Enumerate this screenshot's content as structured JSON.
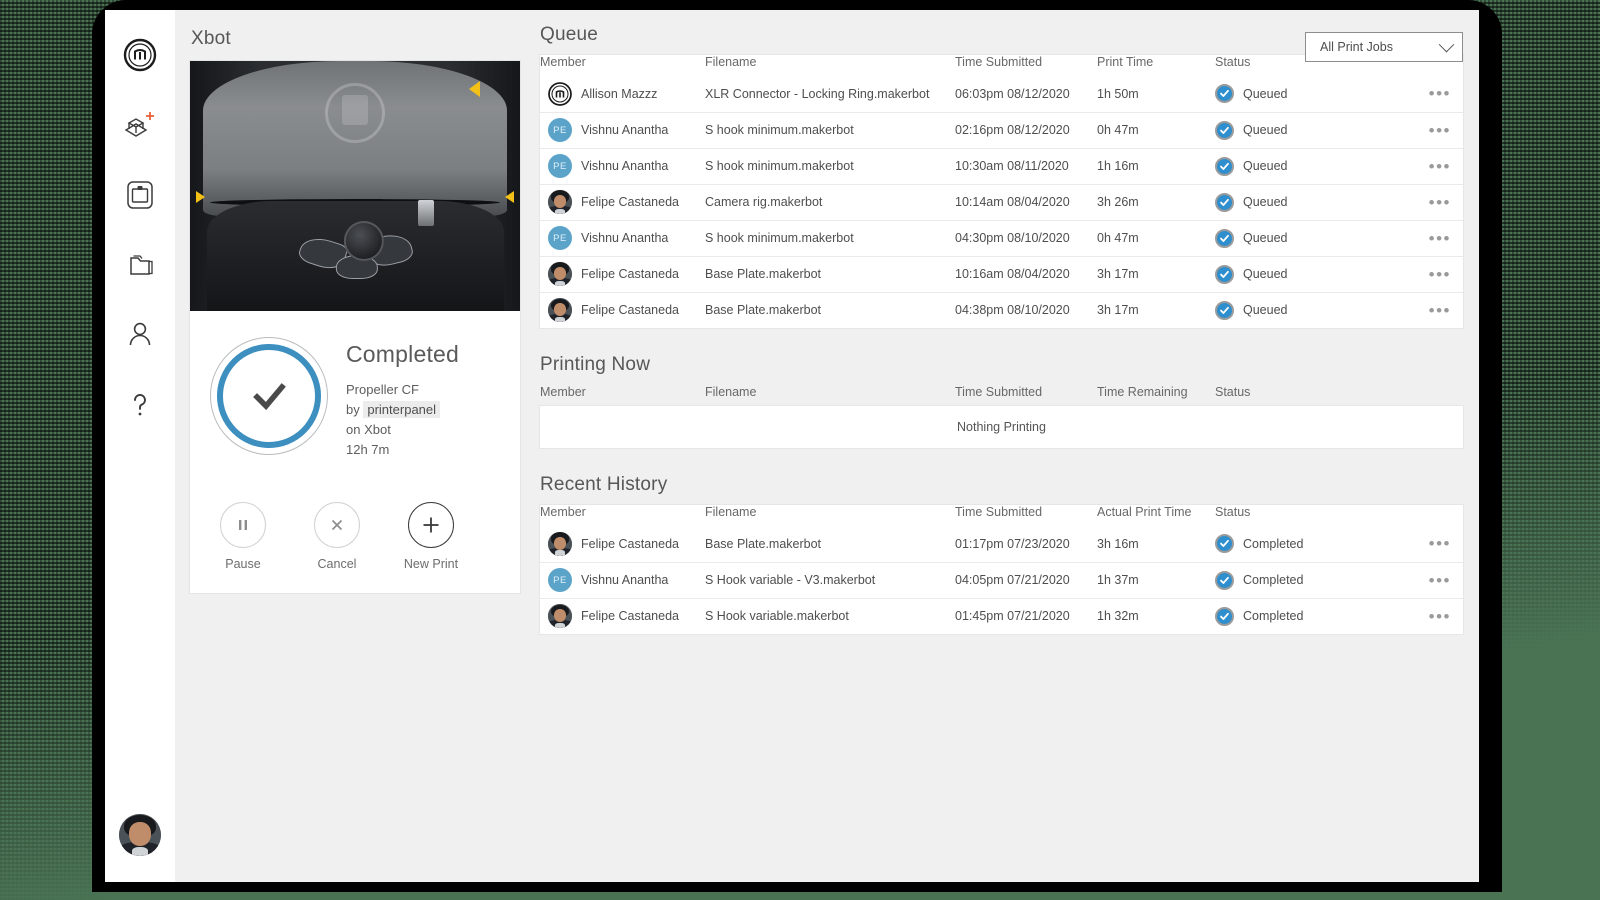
{
  "window": {
    "title": "Xbot"
  },
  "sidebar": {
    "items": [
      {
        "name": "makerbot-logo",
        "label": "MakerBot"
      },
      {
        "name": "add-print-icon",
        "label": "Add Print"
      },
      {
        "name": "printer-icon",
        "label": "Printers"
      },
      {
        "name": "library-folder-icon",
        "label": "Library"
      },
      {
        "name": "account-icon",
        "label": "Account"
      },
      {
        "name": "help-icon",
        "label": "Help"
      }
    ],
    "avatar_label": "Felipe Castaneda"
  },
  "printer_card": {
    "status_heading": "Completed",
    "job_name": "Propeller CF",
    "by_prefix": "by",
    "by_user": "printerpanel",
    "on_line": "on Xbot",
    "duration": "12h 7m",
    "actions": [
      {
        "name": "pause-button",
        "label": "Pause",
        "icon": "pause-icon"
      },
      {
        "name": "cancel-button",
        "label": "Cancel",
        "icon": "close-icon"
      },
      {
        "name": "new-print-button",
        "label": "New Print",
        "icon": "plus-icon"
      }
    ]
  },
  "filter": {
    "selected": "All Print Jobs"
  },
  "queue": {
    "title": "Queue",
    "columns": [
      "Member",
      "Filename",
      "Time Submitted",
      "Print Time",
      "Status"
    ],
    "rows": [
      {
        "avatar": "brand",
        "initials": "",
        "member": "Allison Mazzz",
        "filename": "XLR Connector - Locking Ring.makerbot",
        "submitted": "06:03pm 08/12/2020",
        "print_time": "1h 50m",
        "status": "Queued"
      },
      {
        "avatar": "initials",
        "initials": "PE",
        "member": "Vishnu Anantha",
        "filename": "S hook minimum.makerbot",
        "submitted": "02:16pm 08/12/2020",
        "print_time": "0h 47m",
        "status": "Queued"
      },
      {
        "avatar": "initials",
        "initials": "PE",
        "member": "Vishnu Anantha",
        "filename": "S hook minimum.makerbot",
        "submitted": "10:30am 08/11/2020",
        "print_time": "1h 16m",
        "status": "Queued"
      },
      {
        "avatar": "photo",
        "initials": "",
        "member": "Felipe Castaneda",
        "filename": "Camera rig.makerbot",
        "submitted": "10:14am 08/04/2020",
        "print_time": "3h 26m",
        "status": "Queued"
      },
      {
        "avatar": "initials",
        "initials": "PE",
        "member": "Vishnu Anantha",
        "filename": "S hook minimum.makerbot",
        "submitted": "04:30pm 08/10/2020",
        "print_time": "0h 47m",
        "status": "Queued"
      },
      {
        "avatar": "photo",
        "initials": "",
        "member": "Felipe Castaneda",
        "filename": "Base Plate.makerbot",
        "submitted": "10:16am 08/04/2020",
        "print_time": "3h 17m",
        "status": "Queued"
      },
      {
        "avatar": "photo",
        "initials": "",
        "member": "Felipe Castaneda",
        "filename": "Base Plate.makerbot",
        "submitted": "04:38pm 08/10/2020",
        "print_time": "3h 17m",
        "status": "Queued"
      }
    ],
    "row_menu_label": "•••"
  },
  "printing_now": {
    "title": "Printing Now",
    "columns": [
      "Member",
      "Filename",
      "Time Submitted",
      "Time Remaining",
      "Status"
    ],
    "empty_text": "Nothing Printing"
  },
  "recent_history": {
    "title": "Recent History",
    "columns": [
      "Member",
      "Filename",
      "Time Submitted",
      "Actual Print Time",
      "Status"
    ],
    "rows": [
      {
        "avatar": "photo",
        "initials": "",
        "member": "Felipe Castaneda",
        "filename": "Base Plate.makerbot",
        "submitted": "01:17pm 07/23/2020",
        "print_time": "3h 16m",
        "status": "Completed"
      },
      {
        "avatar": "initials",
        "initials": "PE",
        "member": "Vishnu Anantha",
        "filename": "S Hook variable - V3.makerbot",
        "submitted": "04:05pm 07/21/2020",
        "print_time": "1h 37m",
        "status": "Completed"
      },
      {
        "avatar": "photo",
        "initials": "",
        "member": "Felipe Castaneda",
        "filename": "S Hook variable.makerbot",
        "submitted": "01:45pm 07/21/2020",
        "print_time": "1h 32m",
        "status": "Completed"
      }
    ]
  },
  "colors": {
    "accent_blue": "#3d8fc0",
    "status_blue": "#2f8fce",
    "avatar_blue": "#5ba3c9",
    "desktop_green": "#4a7354",
    "panel_bg": "#f0f0f0",
    "plus_orange": "#e8623a"
  }
}
